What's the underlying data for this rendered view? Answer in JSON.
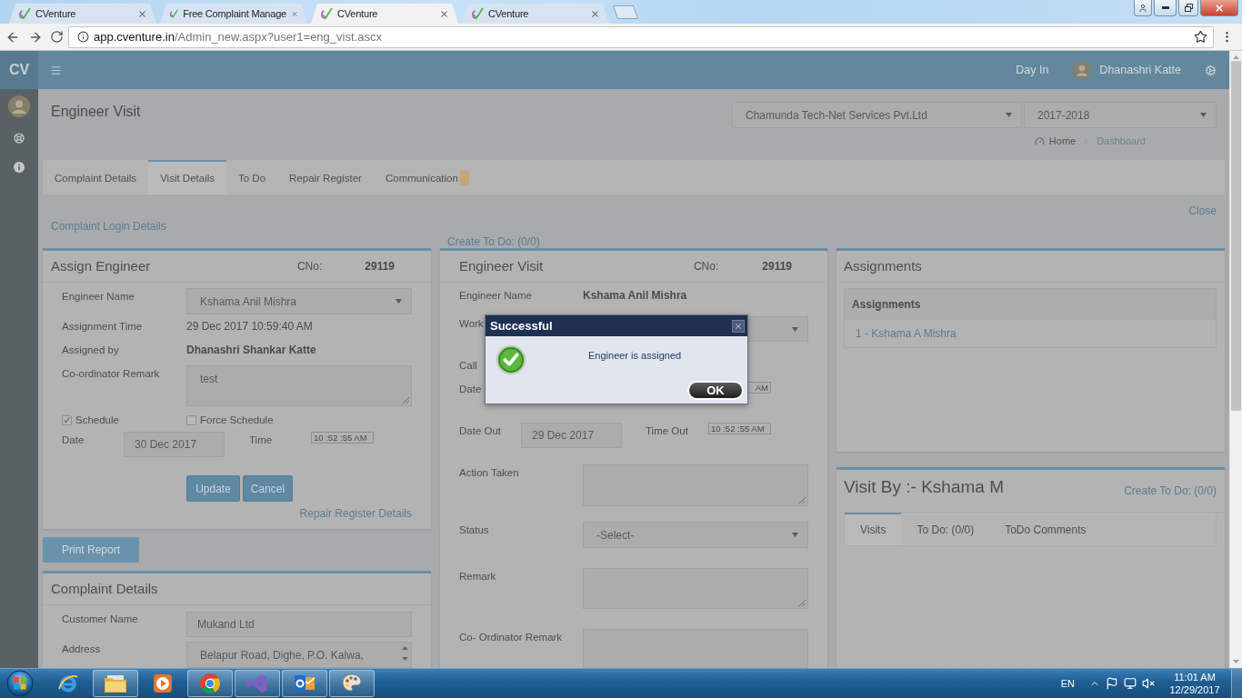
{
  "browser": {
    "tabs": [
      {
        "title": "CVenture",
        "selected": false
      },
      {
        "title": "Free Complaint Manage",
        "selected": false
      },
      {
        "title": "CVenture",
        "selected": true
      },
      {
        "title": "CVenture",
        "selected": false
      }
    ],
    "url_domain": "app.cventure.in",
    "url_path": "/Admin_new.aspx?user1=eng_vist.ascx"
  },
  "header": {
    "logo": "CV",
    "day_in": "Day In",
    "user_name": "Dhanashri Katte"
  },
  "page": {
    "title": "Engineer Visit",
    "company": "Chamunda Tech-Net Services Pvt.Ltd",
    "year": "2017-2018",
    "breadcrumb": [
      "Home",
      "Dashboard"
    ],
    "close_link": "Close",
    "complaint_login_link": "Complaint Login Details",
    "create_todo_link": "Create To Do: (0/0)"
  },
  "tabs": [
    {
      "label": "Complaint Details",
      "selected": false,
      "notification": false
    },
    {
      "label": "Visit Details",
      "selected": true,
      "notification": false
    },
    {
      "label": "To Do",
      "selected": false,
      "notification": false
    },
    {
      "label": "Repair Register",
      "selected": false,
      "notification": false
    },
    {
      "label": "Communication",
      "selected": false,
      "notification": true
    }
  ],
  "assign_engineer": {
    "title": "Assign Engineer",
    "cno_label": "CNo:",
    "cno": "29119",
    "fields": [
      {
        "kind": "select",
        "label": "Engineer Name",
        "value": "Kshama Anil Mishra"
      },
      {
        "kind": "text",
        "label": "Assignment Time",
        "value": "29 Dec 2017 10:59:40 AM"
      },
      {
        "kind": "bold",
        "label": "Assigned by",
        "value": "Dhanashri Shankar Katte"
      },
      {
        "kind": "textarea",
        "label": "Co-ordinator Remark",
        "value": "test"
      }
    ],
    "schedule": {
      "label": "Schedule",
      "checked": true
    },
    "force_schedule": {
      "label": "Force Schedule",
      "checked": false
    },
    "date_label": "Date",
    "date": "30 Dec 2017",
    "time_label": "Time",
    "time": "10 :52 :55 AM",
    "buttons": [
      "Update",
      "Cancel"
    ],
    "repair_link": "Repair Register Details"
  },
  "print_report": "Print Report",
  "complaint_details": {
    "title": "Complaint Details",
    "fields": [
      {
        "kind": "input",
        "label": "Customer Name",
        "value": "Mukand Ltd"
      },
      {
        "kind": "scrollbox",
        "label": "Address",
        "value": "Belapur Road, Dighe, P.O. Kalwa,"
      }
    ]
  },
  "engineer_visit": {
    "title": "Engineer Visit",
    "cno_label": "CNo:",
    "cno": "29119",
    "engineer_name_label": "Engineer Name",
    "engineer_name": "Kshama Anil Mishra",
    "work_label": "Work",
    "call_label": "Call",
    "date_label": "Date",
    "time_partial": "AM",
    "date_out_label": "Date Out",
    "date_out": "29 Dec 2017",
    "time_out_label": "Time Out",
    "time_out": "10 :52 :55 AM",
    "action_label": "Action Taken",
    "status_label": "Status",
    "status": "-Select-",
    "remark_label": "Remark",
    "coordinator_label": "Co- Ordinator Remark"
  },
  "assignments": {
    "title": "Assignments",
    "table_header": "Assignments",
    "rows": [
      "1 - Kshama A Mishra"
    ]
  },
  "visit_by": {
    "title": "Visit By :- Kshama M",
    "create_todo": "Create To Do: (0/0)",
    "tabs": [
      {
        "label": "Visits",
        "selected": true
      },
      {
        "label": "To Do: (0/0)",
        "selected": false
      },
      {
        "label": "ToDo Comments",
        "selected": false
      }
    ]
  },
  "dialog": {
    "title": "Successful",
    "message": "Engineer is assigned",
    "button": "OK"
  },
  "taskbar": {
    "apps": [
      {
        "kind": "web",
        "running": false
      },
      {
        "kind": "folder",
        "running": true
      },
      {
        "kind": "media",
        "running": false
      },
      {
        "kind": "globe",
        "running": true
      },
      {
        "kind": "ribbon",
        "running": true
      },
      {
        "kind": "mail",
        "running": true
      },
      {
        "kind": "palette",
        "running": true
      }
    ],
    "language": "EN",
    "time": "11:01 AM",
    "date": "12/29/2017"
  }
}
